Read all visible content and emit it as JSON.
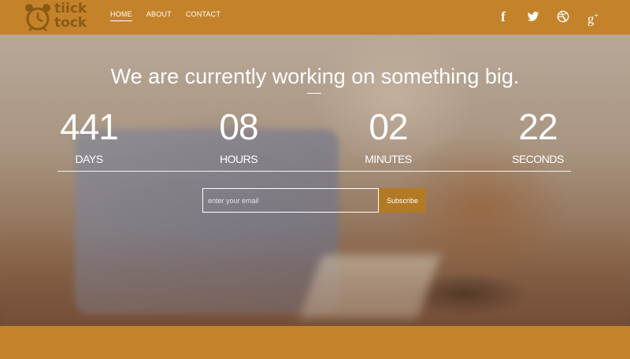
{
  "brand": {
    "line1": "tiick",
    "line2": "tock",
    "icon": "alarm-clock-icon"
  },
  "nav": [
    {
      "label": "HOME",
      "active": true
    },
    {
      "label": "ABOUT",
      "active": false
    },
    {
      "label": "CONTACT",
      "active": false
    }
  ],
  "social": [
    {
      "name": "facebook-icon",
      "glyph": "f"
    },
    {
      "name": "twitter-icon",
      "glyph": "🐦"
    },
    {
      "name": "dribbble-icon",
      "glyph": "◎"
    },
    {
      "name": "google-plus-icon",
      "glyph": "g+"
    }
  ],
  "hero": {
    "headline": "We are currently working on something big.",
    "countdown": {
      "days": {
        "value": "441",
        "label": "DAYS"
      },
      "hours": {
        "value": "08",
        "label": "HOURS"
      },
      "minutes": {
        "value": "02",
        "label": "MINUTES"
      },
      "seconds": {
        "value": "22",
        "label": "SECONDS"
      }
    }
  },
  "subscribe": {
    "placeholder": "enter your email",
    "button": "Subscribe"
  },
  "colors": {
    "brand": "#c4832a",
    "button": "#b27a24",
    "logo": "#8a5a16"
  }
}
